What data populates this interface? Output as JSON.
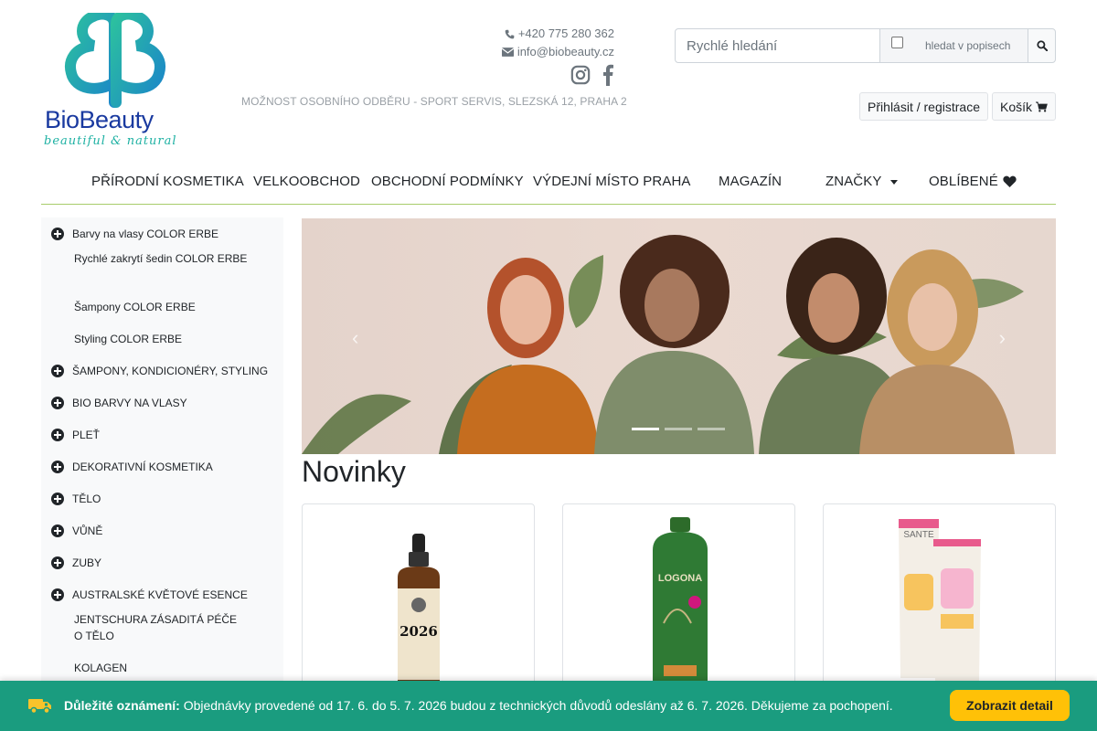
{
  "brand": {
    "name": "BioBeauty",
    "tagline": "beautiful & natural"
  },
  "contact": {
    "phone": "+420 775 280 362",
    "email": "info@biobeauty.cz"
  },
  "pickup_text": "MOŽNOST OSOBNÍHO ODBĚRU - SPORT SERVIS, SLEZSKÁ 12, PRAHA 2",
  "search": {
    "placeholder": "Rychlé hledání",
    "checkbox_label": "hledat v popisech"
  },
  "auth": {
    "login": "Přihlásit / registrace",
    "cart": "Košík"
  },
  "nav": [
    {
      "label": "PŘÍRODNÍ KOSMETIKA"
    },
    {
      "label": "VELKOOBCHOD"
    },
    {
      "label": "OBCHODNÍ PODMÍNKY"
    },
    {
      "label": "VÝDEJNÍ MÍSTO PRAHA"
    },
    {
      "label": "MAGAZÍN"
    },
    {
      "label": "ZNAČKY"
    },
    {
      "label": "OBLÍBENÉ"
    }
  ],
  "sidebar": {
    "categories": [
      {
        "label": "Barvy na vlasy COLOR ERBE"
      },
      {
        "label": "ŠAMPONY, KONDICIONÉRY, STYLING"
      },
      {
        "label": "BIO BARVY NA VLASY"
      },
      {
        "label": "PLEŤ"
      },
      {
        "label": "DEKORATIVNÍ KOSMETIKA"
      },
      {
        "label": "TĚLO"
      },
      {
        "label": "VŮNĚ"
      },
      {
        "label": "ZUBY"
      },
      {
        "label": "AUSTRALSKÉ KVĚTOVÉ ESENCE"
      }
    ],
    "subitems": [
      {
        "label": "Rychlé zakrytí šedin COLOR ERBE"
      },
      {
        "label": "Šampony COLOR ERBE"
      },
      {
        "label": "Styling COLOR ERBE"
      },
      {
        "label": "JENTSCHURA ZÁSADITÁ PÉČE O TĚLO"
      },
      {
        "label": "KOLAGEN"
      }
    ]
  },
  "carousel": {
    "prev": "Previous",
    "next": "Next",
    "slide_count": 3,
    "active_slide": 1
  },
  "section_title": "Novinky",
  "products": [
    {
      "image": "dropper-bottle",
      "label_text": "2026"
    },
    {
      "image": "shampoo-bottle",
      "label_text": "LOGONA"
    },
    {
      "image": "cream-tubes",
      "label_text": "SANTE"
    }
  ],
  "notice": {
    "title": "Důležité oznámení:",
    "message": "Objednávky provedené od 17. 6. do 5. 7. 2026 budou z technických důvodů odeslány až 6. 7. 2026. Děkujeme za pochopení.",
    "button": "Zobrazit detail"
  },
  "colors": {
    "accent": "#1a9c7f",
    "button": "#ffc107",
    "brand_blue": "#1a3aa0",
    "brand_teal": "#1eb1a3",
    "divider": "#a8cc6a"
  }
}
